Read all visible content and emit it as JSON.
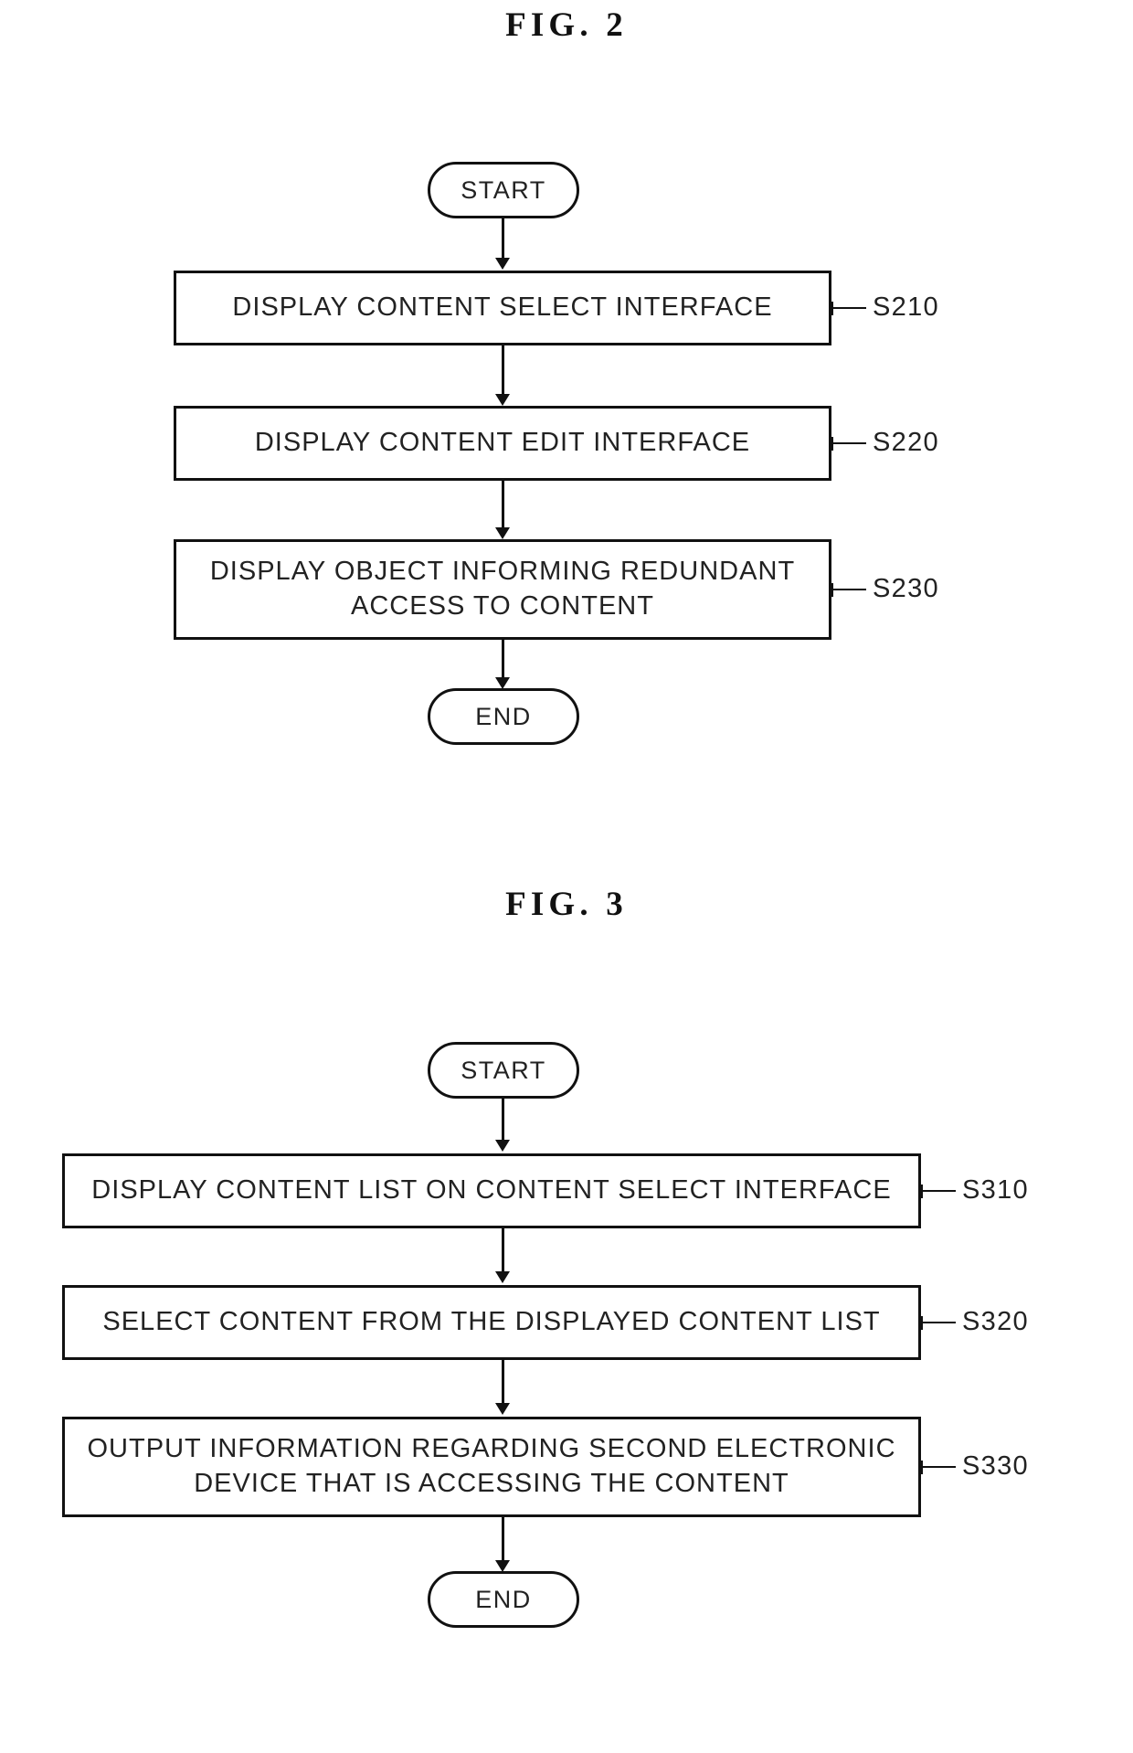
{
  "document": {
    "type": "patent-flowchart-sheet",
    "figures": [
      {
        "id": "fig2",
        "title": "FIG.  2",
        "start_label": "START",
        "end_label": "END",
        "steps": [
          {
            "ref": "S210",
            "text": "DISPLAY CONTENT SELECT INTERFACE",
            "lines": [
              "DISPLAY CONTENT SELECT INTERFACE"
            ]
          },
          {
            "ref": "S220",
            "text": "DISPLAY CONTENT EDIT INTERFACE",
            "lines": [
              "DISPLAY CONTENT EDIT INTERFACE"
            ]
          },
          {
            "ref": "S230",
            "text": "DISPLAY OBJECT INFORMING REDUNDANT ACCESS TO CONTENT",
            "lines": [
              "DISPLAY OBJECT INFORMING REDUNDANT",
              "ACCESS TO CONTENT"
            ]
          }
        ]
      },
      {
        "id": "fig3",
        "title": "FIG.  3",
        "start_label": "START",
        "end_label": "END",
        "steps": [
          {
            "ref": "S310",
            "text": "DISPLAY CONTENT LIST ON CONTENT SELECT INTERFACE",
            "lines": [
              "DISPLAY CONTENT LIST ON CONTENT SELECT INTERFACE"
            ]
          },
          {
            "ref": "S320",
            "text": "SELECT CONTENT FROM THE DISPLAYED CONTENT LIST",
            "lines": [
              "SELECT CONTENT FROM THE DISPLAYED CONTENT LIST"
            ]
          },
          {
            "ref": "S330",
            "text": "OUTPUT INFORMATION REGARDING SECOND ELECTRONIC DEVICE THAT IS ACCESSING THE CONTENT",
            "lines": [
              "OUTPUT INFORMATION REGARDING SECOND ELECTRONIC",
              "DEVICE THAT IS ACCESSING THE CONTENT"
            ]
          }
        ]
      }
    ],
    "colors": {
      "ink": "#111111",
      "text": "#222222",
      "paper": "#ffffff"
    }
  },
  "fig2": {
    "title": "FIG.  2",
    "start": "START",
    "end": "END",
    "step1_line1": "DISPLAY CONTENT SELECT INTERFACE",
    "step1_ref": "S210",
    "step2_line1": "DISPLAY CONTENT EDIT INTERFACE",
    "step2_ref": "S220",
    "step3_line1": "DISPLAY OBJECT INFORMING REDUNDANT",
    "step3_line2": "ACCESS TO CONTENT",
    "step3_ref": "S230"
  },
  "fig3": {
    "title": "FIG.  3",
    "start": "START",
    "end": "END",
    "step1_line1": "DISPLAY CONTENT LIST ON CONTENT SELECT INTERFACE",
    "step1_ref": "S310",
    "step2_line1": "SELECT CONTENT FROM THE DISPLAYED CONTENT LIST",
    "step2_ref": "S320",
    "step3_line1": "OUTPUT INFORMATION REGARDING SECOND ELECTRONIC",
    "step3_line2": "DEVICE THAT IS ACCESSING THE CONTENT",
    "step3_ref": "S330"
  }
}
